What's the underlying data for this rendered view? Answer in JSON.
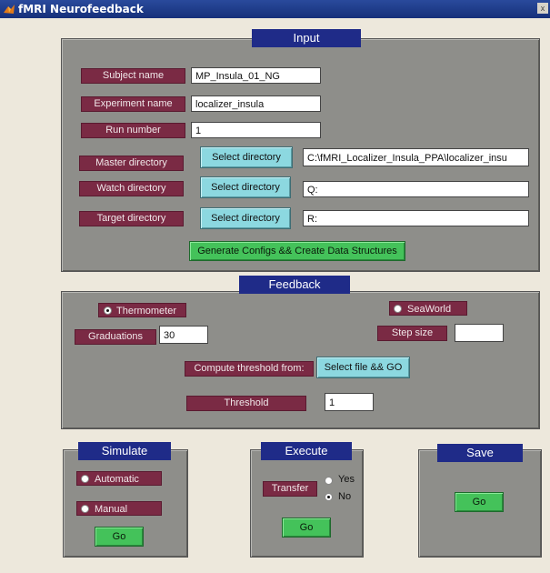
{
  "window": {
    "title": "fMRI Neurofeedback",
    "close_glyph": "x"
  },
  "input": {
    "title": "Input",
    "subject_label": "Subject name",
    "subject_value": "MP_Insula_01_NG",
    "experiment_label": "Experiment name",
    "experiment_value": "localizer_insula",
    "run_label": "Run number",
    "run_value": "1",
    "master_label": "Master directory",
    "master_button": "Select directory",
    "master_value": "C:\\fMRI_Localizer_Insula_PPA\\localizer_insu",
    "watch_label": "Watch directory",
    "watch_button": "Select directory",
    "watch_value": "Q:",
    "target_label": "Target directory",
    "target_button": "Select directory",
    "target_value": "R:",
    "generate_button": "Generate Configs && Create Data Structures"
  },
  "feedback": {
    "title": "Feedback",
    "thermometer_label": "Thermometer",
    "thermometer_selected": true,
    "seaworld_label": "SeaWorld",
    "seaworld_selected": false,
    "graduations_label": "Graduations",
    "graduations_value": "30",
    "stepsize_label": "Step size",
    "stepsize_value": "",
    "compute_label": "Compute threshold from:",
    "compute_button": "Select file && GO",
    "threshold_label": "Threshold",
    "threshold_value": "1"
  },
  "simulate": {
    "title": "Simulate",
    "automatic_label": "Automatic",
    "automatic_selected": false,
    "manual_label": "Manual",
    "manual_selected": false,
    "go_button": "Go"
  },
  "execute": {
    "title": "Execute",
    "transfer_label": "Transfer",
    "yes_label": "Yes",
    "yes_selected": false,
    "no_label": "No",
    "no_selected": true,
    "go_button": "Go"
  },
  "save": {
    "title": "Save",
    "go_button": "Go"
  },
  "colors": {
    "panel": "#8e8e8a",
    "title_bar": "#1f2b88",
    "label": "#7a2a44",
    "cyan_button": "#8cd8e0",
    "green_button": "#44c25a"
  }
}
